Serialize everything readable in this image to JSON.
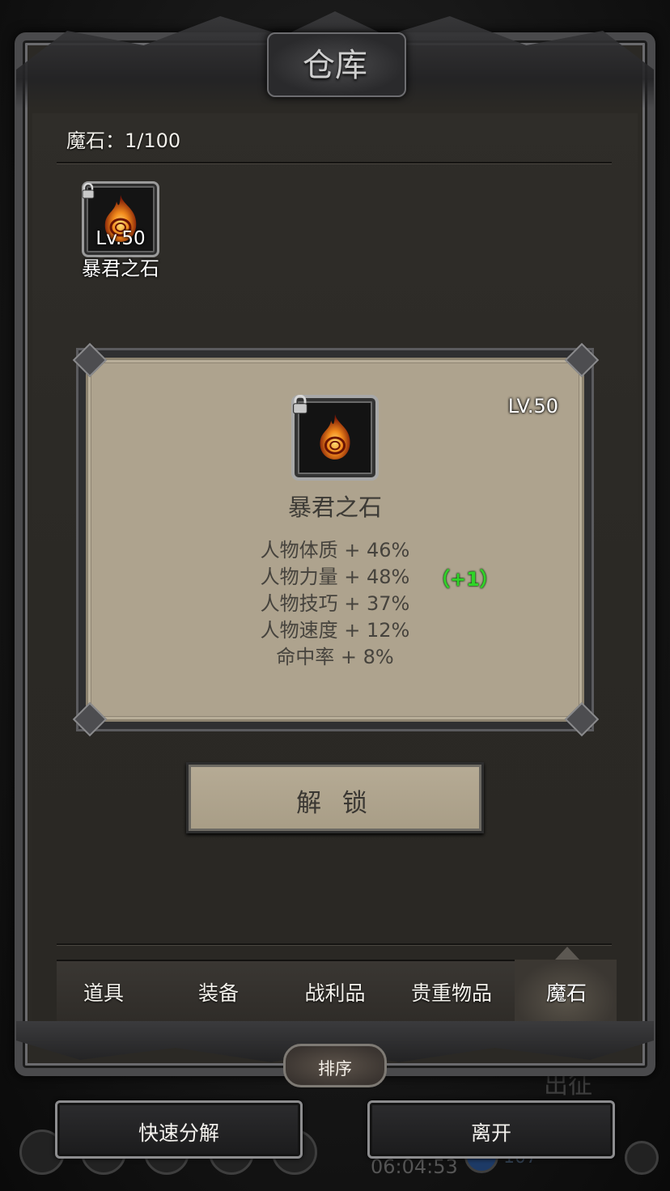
{
  "window": {
    "title": "仓库"
  },
  "inventory": {
    "count_label": "魔石：1/100"
  },
  "slot": {
    "level": "Lv.50",
    "name": "暴君之石",
    "icon": "flame-stone-icon",
    "locked": true
  },
  "detail": {
    "level": "LV.50",
    "name": "暴君之石",
    "icon": "flame-stone-icon",
    "stats": [
      "人物体质 + 46%",
      "人物力量 + 48%",
      "人物技巧 + 37%",
      "人物速度 + 12%",
      "命中率 + 8%"
    ],
    "bonus": "（+1）",
    "colors": {
      "bonus": "#2fd427",
      "panel": "#aea38e"
    }
  },
  "actions": {
    "unlock_label": "解 锁"
  },
  "tabs": [
    {
      "label": "道具"
    },
    {
      "label": "装备"
    },
    {
      "label": "战利品"
    },
    {
      "label": "贵重物品"
    },
    {
      "label": "魔石",
      "active": true
    }
  ],
  "sort_label": "排序",
  "bottom": {
    "quick_decompose_label": "快速分解",
    "leave_label": "离开"
  },
  "background": {
    "expedition_label": "出征",
    "timer": "06:04:53",
    "currency": "107"
  }
}
